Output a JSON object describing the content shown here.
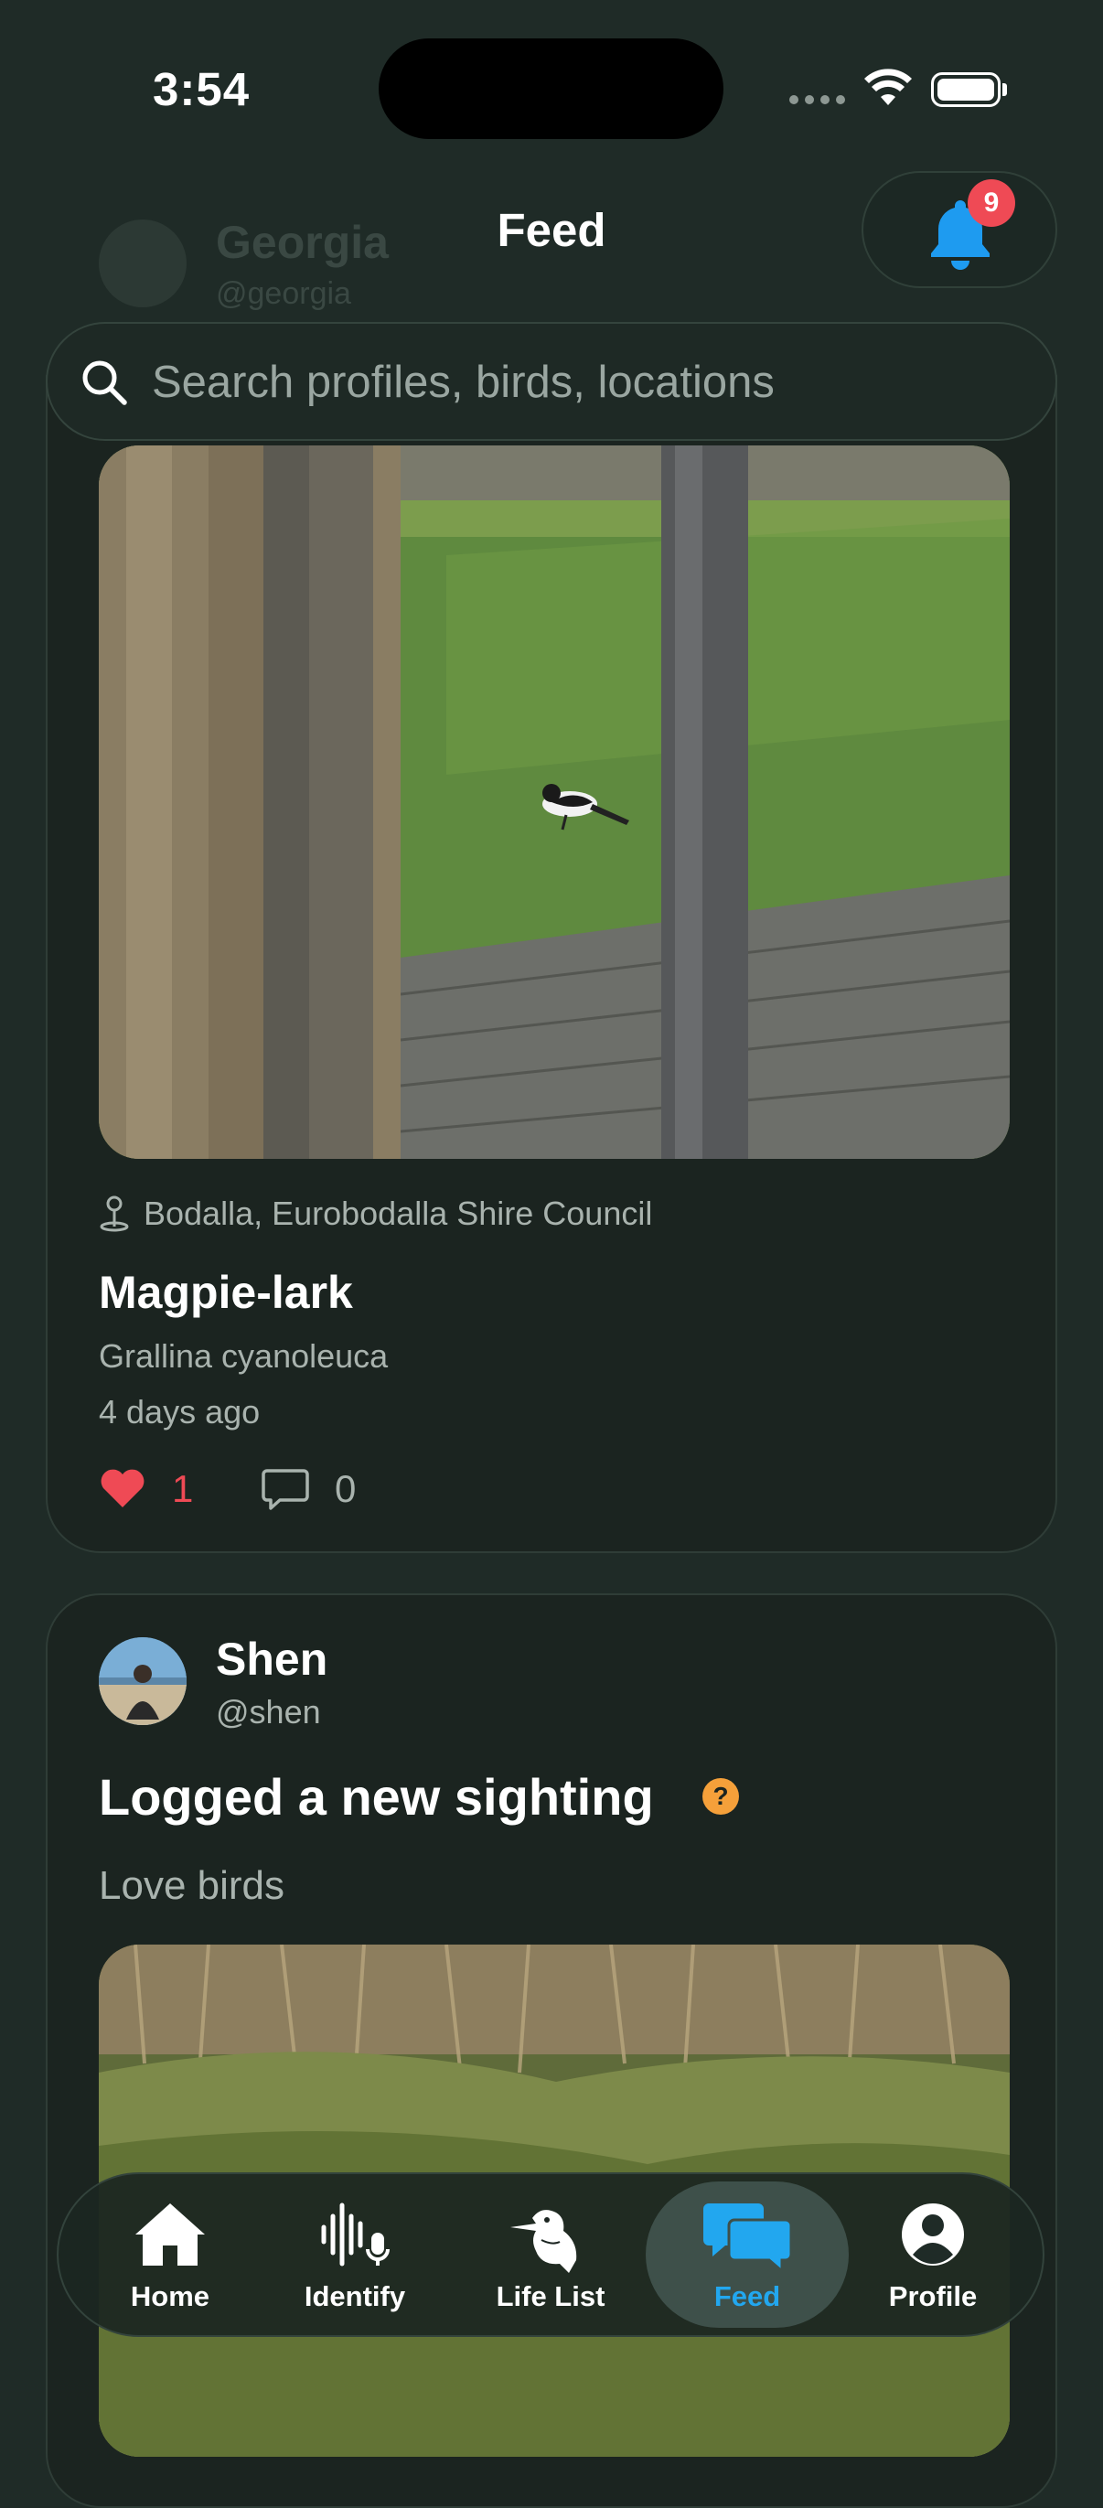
{
  "status_bar": {
    "time": "3:54"
  },
  "background_profile": {
    "name": "Georgia",
    "handle": "@georgia"
  },
  "header": {
    "title": "Feed",
    "notifications": {
      "icon": "bell-icon",
      "count": "9",
      "accent": "#1e9bf0",
      "badge_color": "#ef4a55"
    }
  },
  "search": {
    "placeholder": "Search profiles, birds, locations",
    "value": ""
  },
  "post1": {
    "location": "Bodalla, Eurobodalla Shire Council",
    "common_name": "Magpie-lark",
    "scientific_name": "Grallina cyanoleuca",
    "time_ago": "4 days ago",
    "likes": "1",
    "comments": "0"
  },
  "post2": {
    "user_name": "Shen",
    "user_handle": "@shen",
    "title": "Logged a new sighting",
    "help_glyph": "?",
    "caption": "Love birds"
  },
  "tabbar": {
    "active": "Feed",
    "active_color": "#22a7ef",
    "items": [
      {
        "label": "Home",
        "icon": "home-icon"
      },
      {
        "label": "Identify",
        "icon": "waveform-mic-icon"
      },
      {
        "label": "Life List",
        "icon": "kookaburra-icon"
      },
      {
        "label": "Feed",
        "icon": "chat-bubbles-icon"
      },
      {
        "label": "Profile",
        "icon": "person-circle-icon"
      }
    ]
  }
}
